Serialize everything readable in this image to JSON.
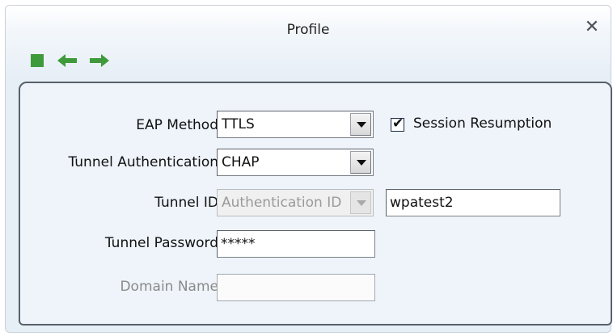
{
  "window": {
    "title": "Profile",
    "close_glyph": "✕"
  },
  "toolbar": {
    "buttons": [
      {
        "name": "stop-icon",
        "color": "#3f9a3c"
      },
      {
        "name": "back-arrow-icon",
        "color": "#3f9a3c"
      },
      {
        "name": "forward-arrow-icon",
        "color": "#3f9a3c"
      }
    ]
  },
  "form": {
    "eap_method": {
      "label": "EAP Method",
      "value": "TTLS"
    },
    "session_resumption": {
      "label": "Session Resumption",
      "checked": true
    },
    "tunnel_authentication": {
      "label": "Tunnel Authentication",
      "value": "CHAP"
    },
    "tunnel_id": {
      "label": "Tunnel ID",
      "type_value": "Authentication ID",
      "value": "wpatest2"
    },
    "tunnel_password": {
      "label": "Tunnel Password",
      "value": "*****"
    },
    "domain_name": {
      "label": "Domain Name",
      "value": ""
    }
  }
}
